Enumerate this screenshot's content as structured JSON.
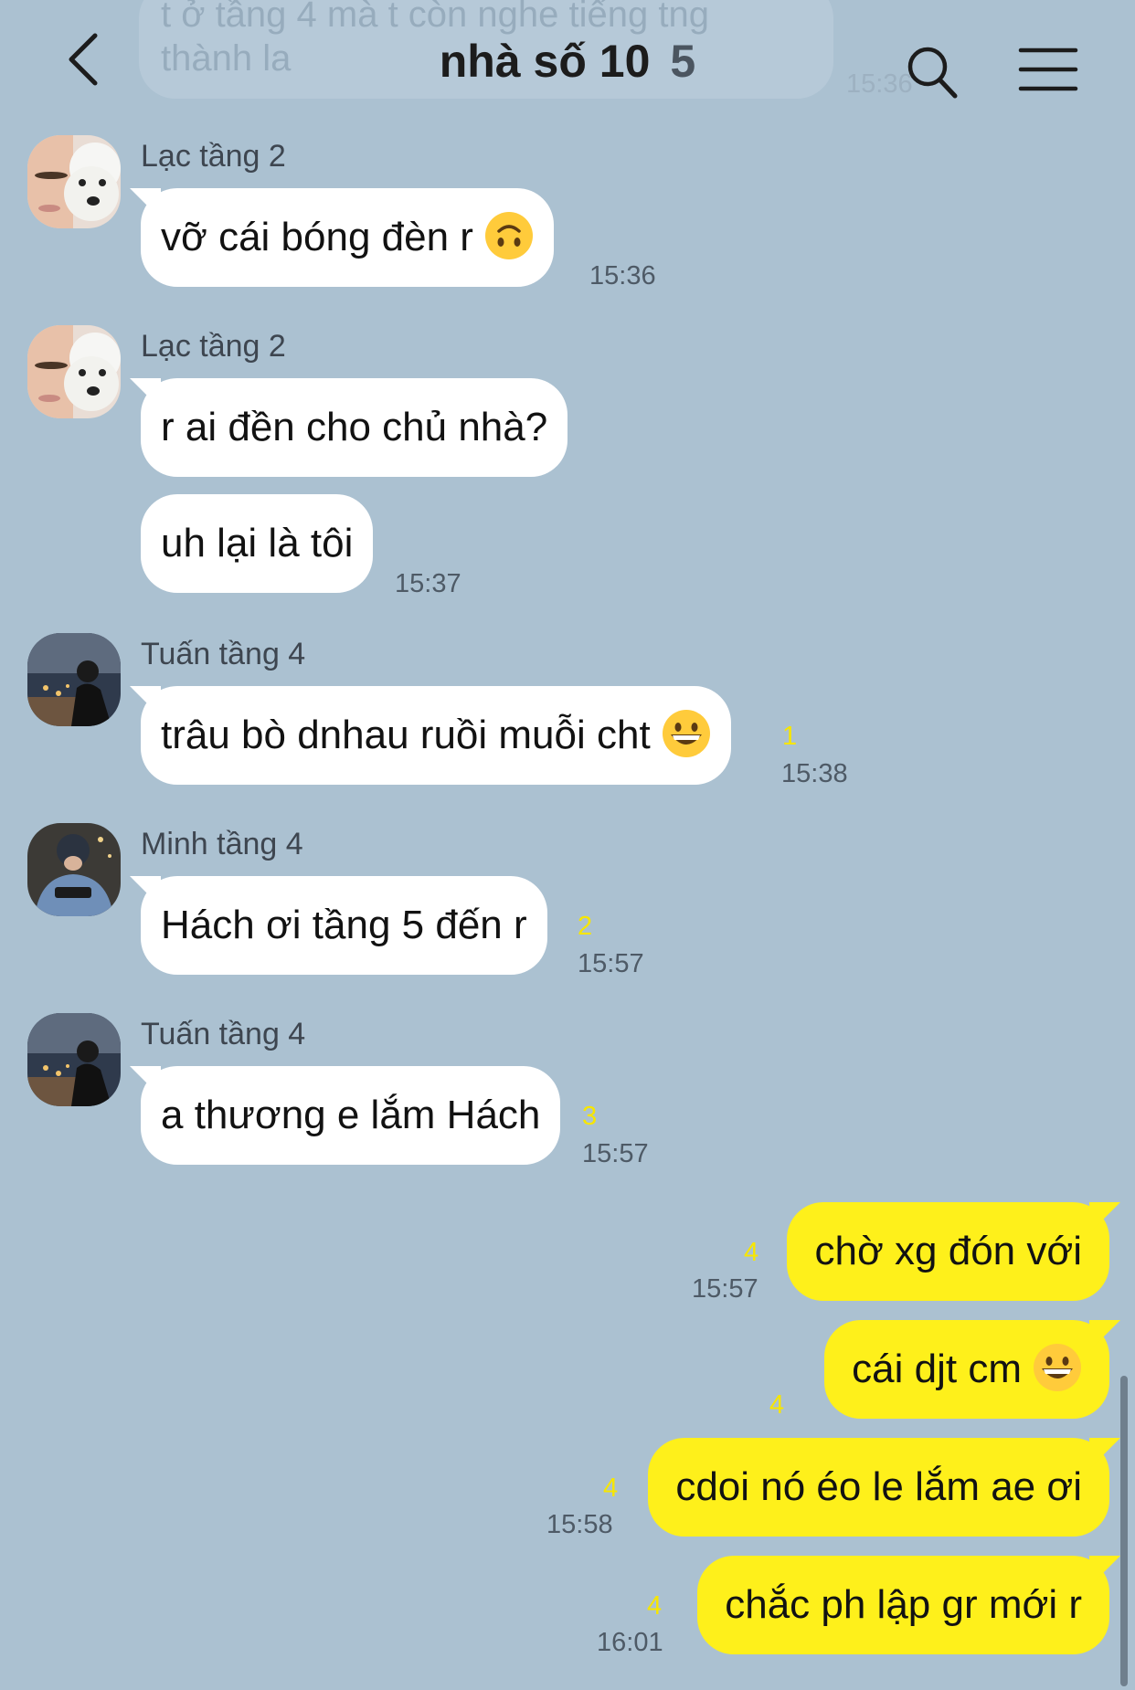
{
  "header": {
    "title": "nhà số 10",
    "member_count": "5",
    "back_icon": "chevron-left-icon",
    "search_icon": "search-icon",
    "menu_icon": "hamburger-menu-icon"
  },
  "previous_message": {
    "text_line1": "t ở tầng 4 mà t còn nghe tiếng tng",
    "text_line2": "thành la",
    "time": "15:36"
  },
  "messages": [
    {
      "sender": "Lạc tầng 2",
      "text": "vỡ cái bóng đèn r",
      "emoji": "upside-down-face",
      "time": "15:36",
      "unread": ""
    },
    {
      "sender": "Lạc tầng 2",
      "text": "r ai đền cho chủ nhà?",
      "time": "",
      "unread": ""
    },
    {
      "sender": "",
      "text": "uh lại là tôi",
      "time": "15:37",
      "unread": ""
    },
    {
      "sender": "Tuấn tầng 4",
      "text": "trâu bò dnhau ruồi muỗi cht",
      "emoji": "grinning-face",
      "time": "15:38",
      "unread": "1"
    },
    {
      "sender": "Minh tầng 4",
      "text": "Hách ơi tầng 5 đến r",
      "time": "15:57",
      "unread": "2"
    },
    {
      "sender": "Tuấn tầng 4",
      "text": "a thương e lắm Hách",
      "time": "15:57",
      "unread": "3"
    }
  ],
  "outgoing": [
    {
      "text": "chờ xg đón với",
      "time": "15:57",
      "unread": "4"
    },
    {
      "text": "cái djt cm",
      "emoji": "grinning-face",
      "time": "",
      "unread": "4"
    },
    {
      "text": "cdoi nó éo le lắm ae ơi",
      "time": "15:58",
      "unread": "4"
    },
    {
      "text": "chắc ph lập gr mới r",
      "time": "16:01",
      "unread": "4"
    }
  ],
  "colors": {
    "background": "#abc1d1",
    "incoming_bubble": "#ffffff",
    "outgoing_bubble": "#fef01b",
    "unread_count": "#f7e600"
  }
}
